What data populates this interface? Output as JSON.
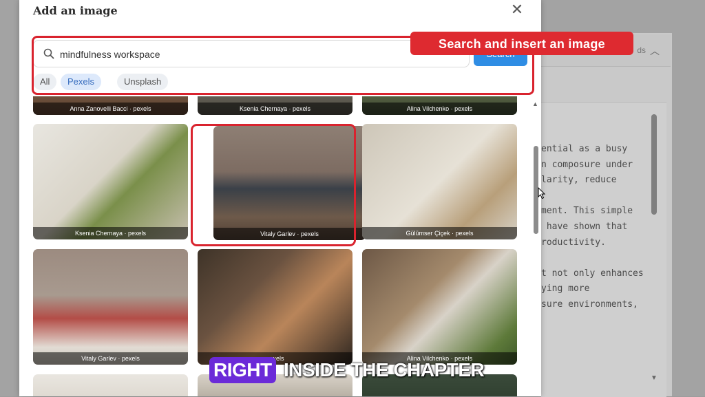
{
  "modal": {
    "title": "Add an image",
    "close_icon": "close-icon"
  },
  "search": {
    "value": "mindfulness workspace",
    "icon": "search-icon",
    "button_label": "Search"
  },
  "filters": [
    {
      "label": "All",
      "active": false
    },
    {
      "label": "Pexels",
      "active": true
    },
    {
      "label": "Unsplash",
      "active": false
    }
  ],
  "callout": "Search and insert an image",
  "results": [
    {
      "caption": "Anna Zanovelli Bacci · pexels"
    },
    {
      "caption": "Ksenia Chernaya · pexels"
    },
    {
      "caption": "Alina Vilchenko · pexels"
    },
    {
      "caption": "Ksenia Chernaya · pexels"
    },
    {
      "caption": "Vitaly Garlev · pexels"
    },
    {
      "caption": "Gülümser Çiçek · pexels"
    },
    {
      "caption": "Vitaly Garlev · pexels"
    },
    {
      "caption": "pexels"
    },
    {
      "caption": "Alina Vilchenko · pexels"
    }
  ],
  "background_panel": {
    "header_text": "ds",
    "code_lines": [
      "ential as a busy",
      "n composure under",
      "larity, reduce",
      "",
      "ment. This simple",
      " have shown that",
      "roductivity.",
      "",
      "t not only enhances",
      "ying more",
      "sure environments,"
    ]
  },
  "subtitle": {
    "highlight": "RIGHT",
    "rest": "INSIDE THE CHAPTER"
  },
  "colors": {
    "accent_red": "#d9232e",
    "search_button": "#2f8de4",
    "subtitle_highlight": "#6b2ad8",
    "chip_active": "#dde9fb"
  }
}
